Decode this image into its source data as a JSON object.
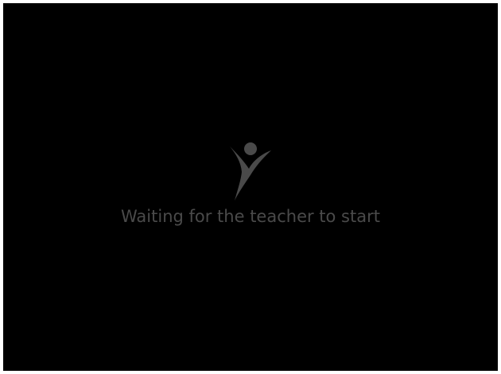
{
  "screen": {
    "status_text": "Waiting for the teacher to start",
    "logo_icon": "person-arms-raised-icon"
  },
  "colors": {
    "background": "#000000",
    "border": "#ffffff",
    "logo": "#4a4a4a",
    "text": "#4a4a4a"
  }
}
